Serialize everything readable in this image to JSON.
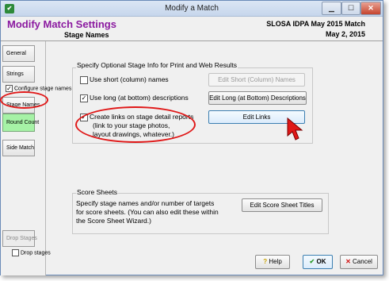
{
  "window": {
    "title": "Modify a Match",
    "icon": "app-icon"
  },
  "header": {
    "title": "Modify Match Settings",
    "subtitle": "Stage Names",
    "match_name": "SLOSA IDPA May 2015 Match",
    "match_date": "May  2, 2015"
  },
  "sidebar": {
    "general": "General",
    "strings": "Strings",
    "configure_stage_names": "Configure stage names",
    "stage_names": "Stage Names",
    "round_count": "Round Count",
    "side_match": "Side Match",
    "drop_stages_btn": "Drop Stages",
    "drop_stages_check": "Drop stages"
  },
  "optional_info": {
    "group_title": "Specify Optional Stage Info for Print and Web Results",
    "use_short": "Use short (column) names",
    "use_short_checked": false,
    "edit_short": "Edit Short (Column) Names",
    "use_long": "Use long (at bottom) descriptions",
    "use_long_checked": true,
    "edit_long": "Edit Long (at Bottom) Descriptions",
    "create_links_line1": "Create links on stage detail reports",
    "create_links_line2": "(link to your stage photos,",
    "create_links_line3": "layout drawings, whatever.)",
    "create_links_checked": true,
    "edit_links": "Edit Links"
  },
  "score_sheets": {
    "title": "Score Sheets",
    "line1": "Specify stage names and/or number of targets",
    "line2": "for score sheets.  (You can also edit these within",
    "line3": "the Score Sheet Wizard.)",
    "edit_titles": "Edit Score Sheet Titles"
  },
  "footer": {
    "help": "Help",
    "ok": "OK",
    "cancel": "Cancel"
  },
  "colors": {
    "title_purple": "#8b1aa0",
    "highlight_red": "#e01818",
    "active_green": "#a6f2a6"
  }
}
